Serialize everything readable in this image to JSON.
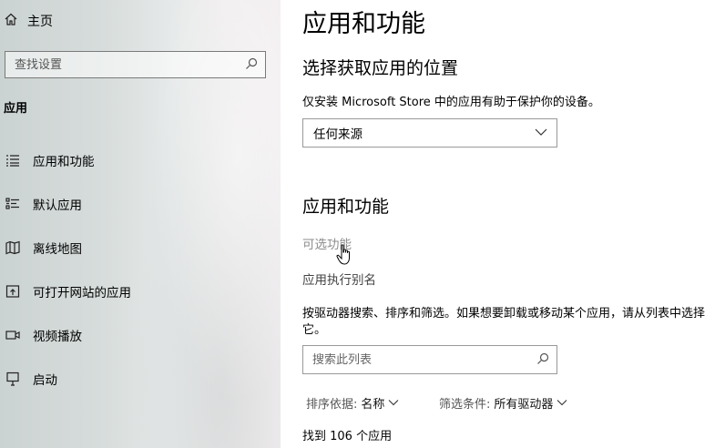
{
  "sidebar": {
    "home_label": "主页",
    "search_placeholder": "查找设置",
    "section_label": "应用",
    "items": [
      {
        "label": "应用和功能",
        "icon": "apps-list-icon"
      },
      {
        "label": "默认应用",
        "icon": "default-apps-icon"
      },
      {
        "label": "离线地图",
        "icon": "offline-maps-icon"
      },
      {
        "label": "可打开网站的应用",
        "icon": "apps-for-websites-icon"
      },
      {
        "label": "视频播放",
        "icon": "video-playback-icon"
      },
      {
        "label": "启动",
        "icon": "startup-icon"
      }
    ]
  },
  "main": {
    "title": "应用和功能",
    "install_section": {
      "heading": "选择获取应用的位置",
      "description": "仅安装 Microsoft Store 中的应用有助于保护你的设备。",
      "dropdown_value": "任何来源"
    },
    "apps_section": {
      "heading": "应用和功能",
      "optional_features_link": "可选功能",
      "app_alias_link": "应用执行别名",
      "description": "按驱动器搜索、排序和筛选。如果想要卸载或移动某个应用，请从列表中选择它。",
      "search_placeholder": "搜索此列表",
      "sort_label": "排序依据:",
      "sort_value": "名称",
      "filter_label": "筛选条件:",
      "filter_value": "所有驱动器",
      "count_text": "找到 106 个应用"
    }
  },
  "colors": {
    "text": "#000000",
    "link_disabled": "#8c8c8c",
    "border": "#999999"
  }
}
